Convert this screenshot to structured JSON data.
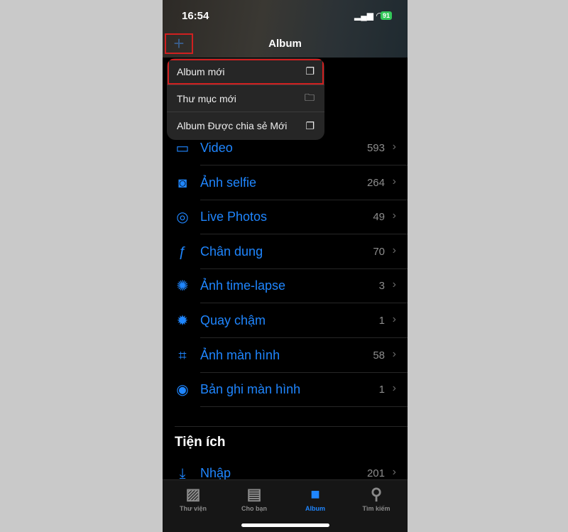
{
  "status": {
    "time": "16:54",
    "battery": "91"
  },
  "header": {
    "title": "Album",
    "add_icon": "plus-icon"
  },
  "menu": [
    {
      "label": "Album mới",
      "icon": "new-album-icon"
    },
    {
      "label": "Thư mục mới",
      "icon": "new-folder-icon"
    },
    {
      "label": "Album Được chia sẻ Mới",
      "icon": "shared-album-icon"
    }
  ],
  "media_types": [
    {
      "label": "Video",
      "count": "593",
      "icon": "▭"
    },
    {
      "label": "Ảnh selfie",
      "count": "264",
      "icon": "◙"
    },
    {
      "label": "Live Photos",
      "count": "49",
      "icon": "◎"
    },
    {
      "label": "Chân dung",
      "count": "70",
      "icon": "ƒ"
    },
    {
      "label": "Ảnh time-lapse",
      "count": "3",
      "icon": "✺"
    },
    {
      "label": "Quay chậm",
      "count": "1",
      "icon": "✹"
    },
    {
      "label": "Ảnh màn hình",
      "count": "58",
      "icon": "⌗"
    },
    {
      "label": "Bản ghi màn hình",
      "count": "1",
      "icon": "◉"
    }
  ],
  "utilities": {
    "title": "Tiện ích",
    "items": [
      {
        "label": "Nhập",
        "count": "201",
        "icon": "⤓"
      }
    ]
  },
  "tabs": [
    {
      "label": "Thư viện",
      "glyph": "▨"
    },
    {
      "label": "Cho bạn",
      "glyph": "▤"
    },
    {
      "label": "Album",
      "glyph": "■",
      "active": true
    },
    {
      "label": "Tìm kiếm",
      "glyph": "⚲"
    }
  ],
  "colors": {
    "accent": "#1f86ff",
    "highlight": "#d02020"
  }
}
